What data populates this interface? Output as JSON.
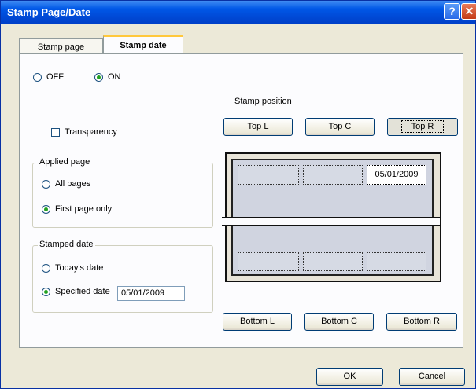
{
  "window": {
    "title": "Stamp Page/Date",
    "help_glyph": "?",
    "close_glyph": "✕"
  },
  "tabs": [
    {
      "label": "Stamp page",
      "active": false
    },
    {
      "label": "Stamp date",
      "active": true
    }
  ],
  "mode": {
    "off_label": "OFF",
    "on_label": "ON",
    "selected": "ON"
  },
  "transparency": {
    "label": "Transparency",
    "checked": false
  },
  "applied_page": {
    "title": "Applied page",
    "options": [
      {
        "label": "All pages",
        "selected": false
      },
      {
        "label": "First page only",
        "selected": true
      }
    ]
  },
  "stamped_date": {
    "title": "Stamped date",
    "options": [
      {
        "label": "Today's date",
        "selected": false
      },
      {
        "label": "Specified date",
        "selected": true
      }
    ],
    "date_value": "05/01/2009"
  },
  "stamp_position": {
    "label": "Stamp position",
    "top_buttons": [
      "Top L",
      "Top C",
      "Top R"
    ],
    "bottom_buttons": [
      "Bottom L",
      "Bottom C",
      "Bottom R"
    ],
    "selected": "Top R",
    "preview_text": "05/01/2009"
  },
  "footer": {
    "ok_label": "OK",
    "cancel_label": "Cancel"
  }
}
